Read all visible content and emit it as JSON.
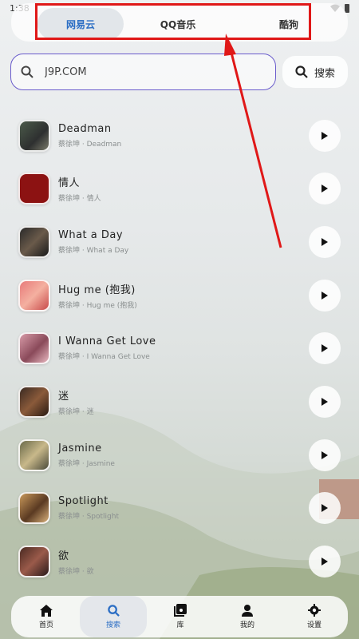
{
  "status": {
    "time": "1:38"
  },
  "source_tabs": [
    {
      "label": "网易云",
      "active": true
    },
    {
      "label": "QQ音乐",
      "active": false
    },
    {
      "label": "酷狗",
      "active": false
    }
  ],
  "search": {
    "value": "J9P.COM",
    "placeholder": "",
    "button_label": "搜索"
  },
  "songs": [
    {
      "title": "Deadman",
      "subtitle": "蔡徐坤 · Deadman"
    },
    {
      "title": "情人",
      "subtitle": "蔡徐坤 · 情人"
    },
    {
      "title": "What a Day",
      "subtitle": "蔡徐坤 · What a Day"
    },
    {
      "title": "Hug me (抱我)",
      "subtitle": "蔡徐坤 · Hug me (抱我)"
    },
    {
      "title": "I Wanna Get Love",
      "subtitle": "蔡徐坤 · I Wanna Get Love"
    },
    {
      "title": "迷",
      "subtitle": "蔡徐坤 · 迷"
    },
    {
      "title": "Jasmine",
      "subtitle": "蔡徐坤 · Jasmine"
    },
    {
      "title": "Spotlight",
      "subtitle": "蔡徐坤 · Spotlight"
    },
    {
      "title": "欲",
      "subtitle": "蔡徐坤 · 欲"
    }
  ],
  "bottom_nav": [
    {
      "label": "首页",
      "icon": "home-icon",
      "active": false
    },
    {
      "label": "搜索",
      "icon": "search-icon",
      "active": true
    },
    {
      "label": "库",
      "icon": "library-icon",
      "active": false
    },
    {
      "label": "我的",
      "icon": "person-icon",
      "active": false
    },
    {
      "label": "设置",
      "icon": "gear-icon",
      "active": false
    }
  ],
  "colors": {
    "accent": "#2a6dc4",
    "highlight": "#e01818",
    "search_border": "#6a5ccc"
  }
}
